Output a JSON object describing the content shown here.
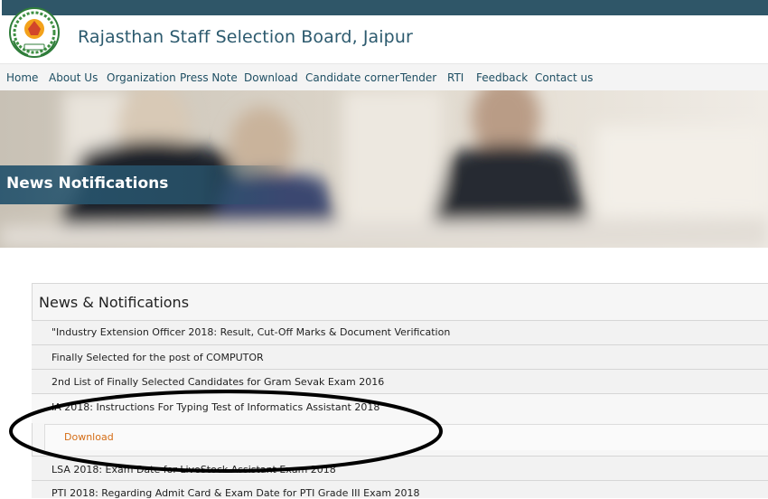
{
  "header": {
    "title": "Rajasthan Staff Selection Board, Jaipur",
    "logo_icon": "rsmssb-emblem-icon"
  },
  "nav": {
    "items": [
      "Home",
      "About Us",
      "Organization",
      "Press Note",
      "Download",
      "Candidate corner",
      "Tender",
      "RTI",
      "Feedback",
      "Contact us"
    ]
  },
  "banner": {
    "title": "News Notifications"
  },
  "news": {
    "title": "News & Notifications",
    "items": [
      "\"Industry Extension Officer 2018: Result, Cut-Off Marks & Document Verification",
      "Finally Selected for the post of COMPUTOR",
      "2nd List of Finally Selected Candidates for Gram Sevak Exam 2016",
      "IA 2018: Instructions For Typing Test of Informatics Assistant 2018",
      "LSA 2018: Exam Date for LiveStock Assistant Exam 2018",
      "PTI 2018: Regarding Admit Card & Exam Date for PTI Grade III Exam 2018"
    ],
    "download_label": "Download"
  },
  "colors": {
    "topbar": "#2f5668",
    "title": "#2c5a6e",
    "nav_text": "#1f4f63",
    "download_link": "#d46d16"
  }
}
